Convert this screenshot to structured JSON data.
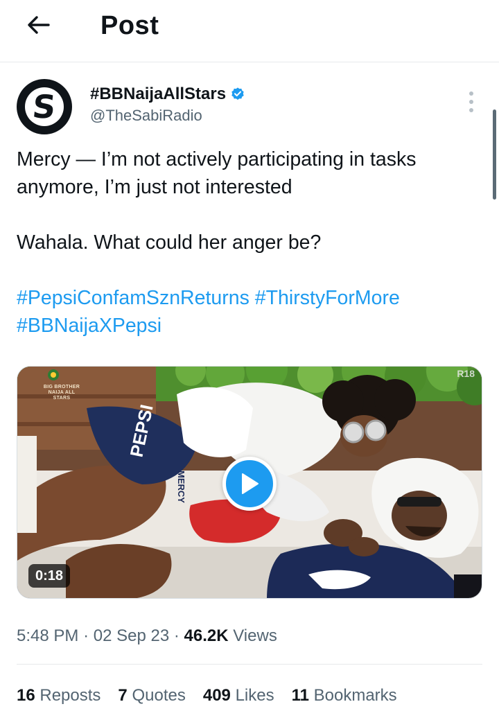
{
  "header": {
    "back_icon": "arrow-left-icon",
    "title": "Post"
  },
  "author": {
    "avatar_letter": "S",
    "display_name": "#BBNaijaAllStars",
    "verified_icon": "verified-badge-icon",
    "handle": "@TheSabiRadio",
    "more_icon": "more-vertical-icon"
  },
  "tweet": {
    "lines": [
      "Mercy — I’m not actively participating in tasks anymore, I’m just not interested",
      "Wahala. What could her anger be?"
    ],
    "hashtags": [
      "#PepsiConfamSznReturns",
      "#ThirstyForMore",
      "#BBNaijaXPepsi"
    ]
  },
  "media": {
    "duration": "0:18",
    "rating_badge": "R18",
    "play_icon": "play-icon",
    "shirt_text": "PEPSI",
    "name_tag": "MERCY",
    "bug_text": "BIG BROTHER NAIJA ALL STARS",
    "accent_color": "#1d9bf0"
  },
  "meta": {
    "time": "5:48 PM",
    "date": "02 Sep 23",
    "views_count": "46.2K",
    "views_label": "Views",
    "separator": "·"
  },
  "stats": {
    "reposts": {
      "count": "16",
      "label": "Reposts"
    },
    "quotes": {
      "count": "7",
      "label": "Quotes"
    },
    "likes": {
      "count": "409",
      "label": "Likes"
    },
    "bookmarks": {
      "count": "11",
      "label": "Bookmarks"
    }
  }
}
